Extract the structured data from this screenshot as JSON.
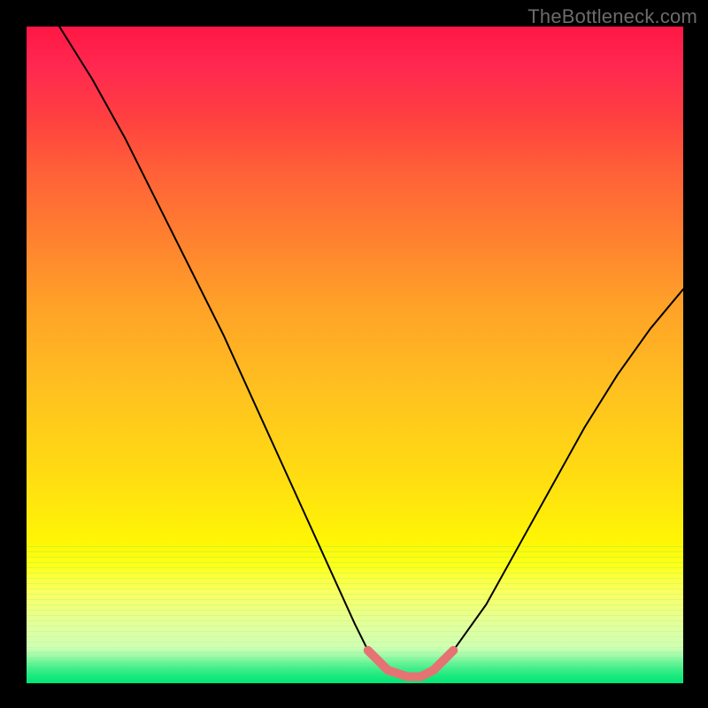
{
  "watermark": "TheBottleneck.com",
  "chart_data": {
    "type": "line",
    "title": "",
    "xlabel": "",
    "ylabel": "",
    "xlim": [
      0,
      100
    ],
    "ylim": [
      0,
      100
    ],
    "grid": false,
    "legend": false,
    "description": "Bottleneck-style V-curve on a red→yellow→green vertical heat gradient; a salmon arc marks the flat optimum region at the bottom of the curve.",
    "series": [
      {
        "name": "bottleneck-curve",
        "color": "#000000",
        "x": [
          5,
          10,
          15,
          20,
          25,
          30,
          35,
          40,
          45,
          50,
          52,
          55,
          58,
          60,
          62,
          65,
          70,
          75,
          80,
          85,
          90,
          95,
          100
        ],
        "values": [
          100,
          92,
          83,
          73,
          63,
          53,
          42,
          31,
          20,
          9,
          5,
          2,
          1,
          1,
          2,
          5,
          12,
          21,
          30,
          39,
          47,
          54,
          60
        ]
      },
      {
        "name": "optimum-marker",
        "color": "#e57373",
        "x": [
          52,
          55,
          58,
          60,
          62,
          65
        ],
        "values": [
          5,
          2,
          1,
          1,
          2,
          5
        ]
      }
    ],
    "background_gradient_stops": [
      {
        "pos": 0.0,
        "color": "#ff1744"
      },
      {
        "pos": 0.14,
        "color": "#ff4040"
      },
      {
        "pos": 0.32,
        "color": "#ff8030"
      },
      {
        "pos": 0.55,
        "color": "#ffc020"
      },
      {
        "pos": 0.82,
        "color": "#ffff00"
      },
      {
        "pos": 0.96,
        "color": "#d0ffc8"
      },
      {
        "pos": 1.0,
        "color": "#00e676"
      }
    ]
  }
}
